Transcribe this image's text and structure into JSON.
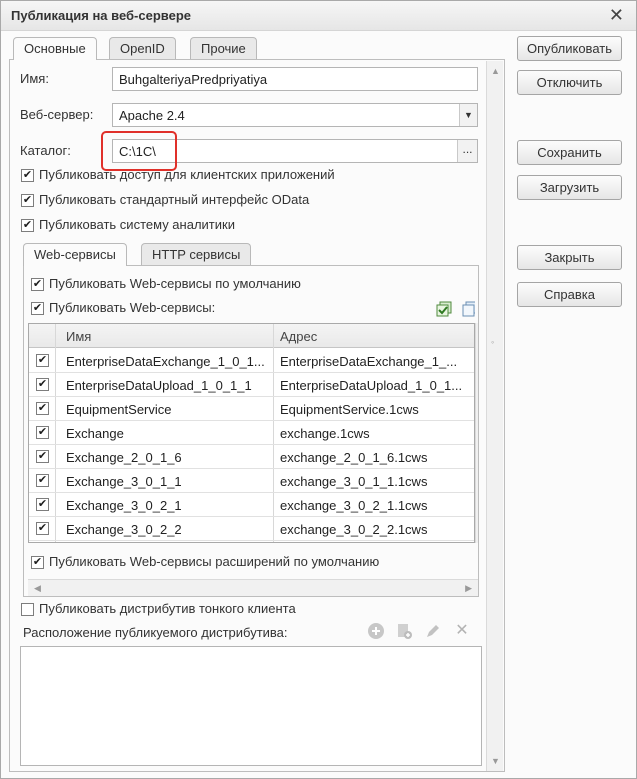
{
  "window": {
    "title": "Публикация на веб-сервере"
  },
  "tabs": [
    "Основные",
    "OpenID",
    "Прочие"
  ],
  "fields": {
    "name_label": "Имя:",
    "name_value": "BuhgalteriyaPredpriyatiya",
    "server_label": "Веб-сервер:",
    "server_value": "Apache 2.4",
    "catalog_label": "Каталог:",
    "catalog_value": "C:\\1C\\"
  },
  "checkboxes": [
    "Публиковать доступ для клиентских приложений",
    "Публиковать стандартный интерфейс OData",
    "Публиковать систему аналитики"
  ],
  "inner_tabs": [
    "Web-сервисы",
    "HTTP сервисы"
  ],
  "ws_checks": {
    "default": "Публиковать Web-сервисы по умолчанию",
    "publish": "Публиковать Web-сервисы:",
    "extensions": "Публиковать Web-сервисы расширений по умолчанию"
  },
  "grid": {
    "columns": [
      "Имя",
      "Адрес"
    ],
    "rows": [
      {
        "name": "EnterpriseDataExchange_1_0_1...",
        "address": "EnterpriseDataExchange_1_..."
      },
      {
        "name": "EnterpriseDataUpload_1_0_1_1",
        "address": "EnterpriseDataUpload_1_0_1..."
      },
      {
        "name": "EquipmentService",
        "address": "EquipmentService.1cws"
      },
      {
        "name": "Exchange",
        "address": "exchange.1cws"
      },
      {
        "name": "Exchange_2_0_1_6",
        "address": "exchange_2_0_1_6.1cws"
      },
      {
        "name": "Exchange_3_0_1_1",
        "address": "exchange_3_0_1_1.1cws"
      },
      {
        "name": "Exchange_3_0_2_1",
        "address": "exchange_3_0_2_1.1cws"
      },
      {
        "name": "Exchange_3_0_2_2",
        "address": "exchange_3_0_2_2.1cws"
      }
    ]
  },
  "thin_client": {
    "check": "Публиковать дистрибутив тонкого клиента",
    "location_label": "Расположение публикуемого дистрибутива:"
  },
  "buttons": {
    "publish": "Опубликовать",
    "disable": "Отключить",
    "save": "Сохранить",
    "load": "Загрузить",
    "close": "Закрыть",
    "help": "Справка"
  },
  "colors": {
    "highlight": "#e0302a"
  }
}
